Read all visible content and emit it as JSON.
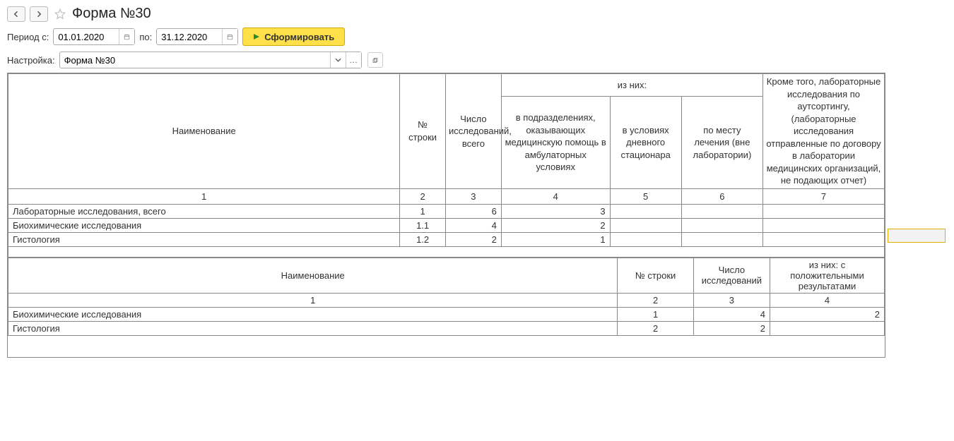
{
  "title": "Форма №30",
  "period": {
    "label_from": "Период с:",
    "date_from": "01.01.2020",
    "label_to": "по:",
    "date_to": "31.12.2020"
  },
  "form_btn": "Сформировать",
  "settings": {
    "label": "Настройка:",
    "value": "Форма №30"
  },
  "table1": {
    "headers": {
      "name": "Наименование",
      "row_no": "№ строки",
      "total": "Число исследований, всего",
      "of_them": "из них:",
      "sub1": "в подразделениях, оказывающих медицинскую помощь в амбулаторных условиях",
      "sub2": "в условиях дневного стационара",
      "sub3": "по месту лечения (вне лаборатории)",
      "outsourcing": "Кроме того, лабораторные исследования по аутсортингу, (лабораторные исследования отправленные по договору в лаборатории медицинских организаций, не подающих отчет)"
    },
    "index_row": [
      "1",
      "2",
      "3",
      "4",
      "5",
      "6",
      "7"
    ],
    "rows": [
      {
        "name": "Лабораторные исследования, всего",
        "no": "1",
        "total": "6",
        "sub1": "3",
        "sub2": "",
        "sub3": "",
        "out": ""
      },
      {
        "name": "Биохимические исследования",
        "no": "1.1",
        "total": "4",
        "sub1": "2",
        "sub2": "",
        "sub3": "",
        "out": ""
      },
      {
        "name": "Гистология",
        "no": "1.2",
        "total": "2",
        "sub1": "1",
        "sub2": "",
        "sub3": "",
        "out": ""
      }
    ]
  },
  "table2": {
    "headers": {
      "name": "Наименование",
      "row_no": "№ строки",
      "count": "Число исследований",
      "positive": "из них: с положительными результатами"
    },
    "index_row": [
      "1",
      "2",
      "3",
      "4"
    ],
    "rows": [
      {
        "name": "Биохимические исследования",
        "no": "1",
        "count": "4",
        "pos": "2"
      },
      {
        "name": "Гистология",
        "no": "2",
        "count": "2",
        "pos": ""
      }
    ]
  }
}
